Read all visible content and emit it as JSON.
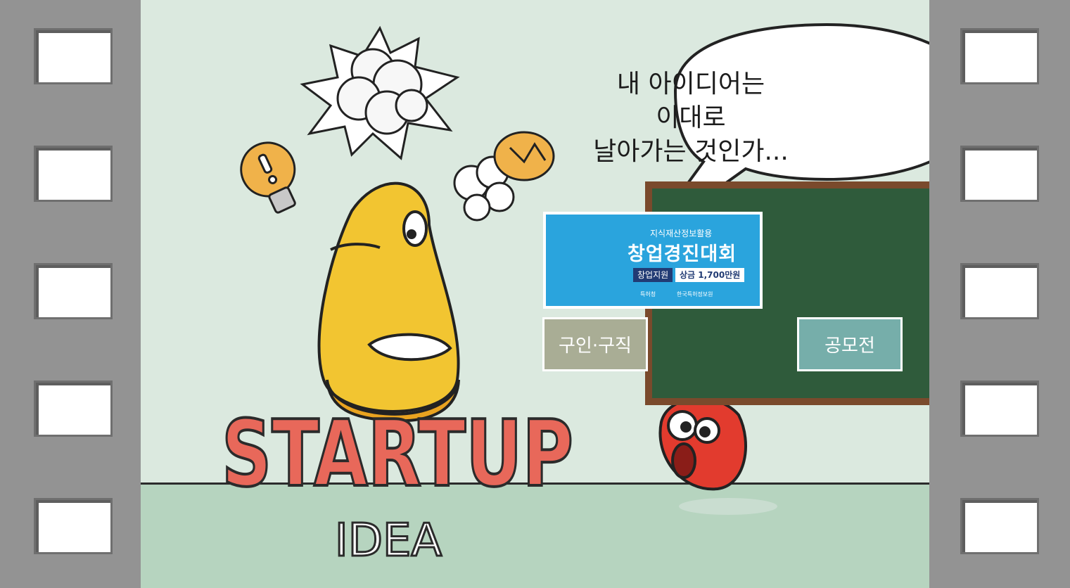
{
  "speech_bubble": {
    "line1": "내 아이디어는",
    "line2": "이대로",
    "line3": "날아가는 것인가..."
  },
  "logo": {
    "main": "STARTUP",
    "sub": "IDEA"
  },
  "banner": {
    "subtitle": "지식재산정보활용",
    "title": "창업경진대회",
    "tag_support": "창업지원",
    "tag_prize": "상금 1,700만원",
    "org1": "특허청",
    "org2": "한국특허정보원"
  },
  "buttons": {
    "jobs": "구인·구직",
    "contest": "공모전"
  },
  "colors": {
    "film": "#939393",
    "wall": "#dbe9df",
    "floor": "#b6d4bf",
    "logo_red": "#e8685a",
    "yellow_char": "#f2c531",
    "red_char": "#e23b2e",
    "banner_blue": "#2aa4dd"
  }
}
